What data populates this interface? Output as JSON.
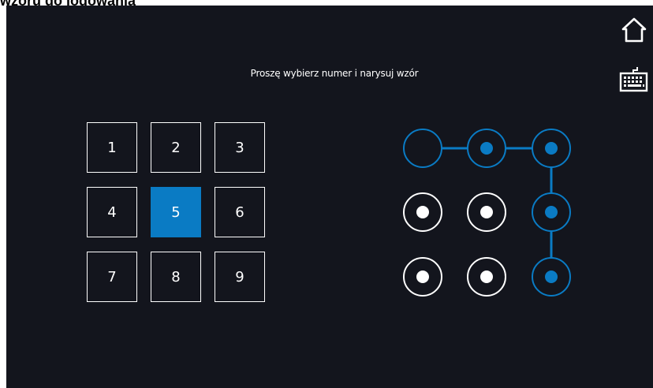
{
  "caption": "wzoru do logowania",
  "instruction": "Proszę wybierz numer i narysuj wzór",
  "toolbar": {
    "home_icon": "home-icon",
    "keyboard_icon": "keyboard-icon"
  },
  "keypad": {
    "keys": [
      "1",
      "2",
      "3",
      "4",
      "5",
      "6",
      "7",
      "8",
      "9"
    ],
    "selected": "5"
  },
  "pattern": {
    "active_nodes": [
      2,
      3,
      6,
      9
    ],
    "path": [
      1,
      2,
      3,
      6,
      9
    ],
    "active_color": "#0a7bc4",
    "inactive_color": "#ffffff"
  },
  "colors": {
    "background": "#13151d",
    "accent": "#0a7bc4"
  }
}
